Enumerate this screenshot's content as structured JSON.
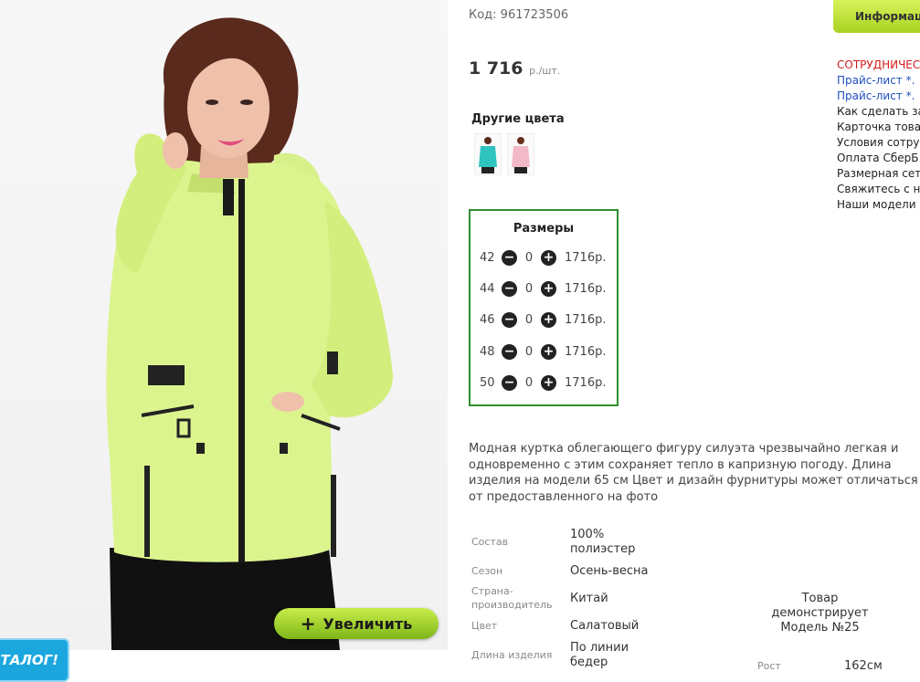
{
  "product": {
    "code": "Код: 961723506",
    "price": "1 716",
    "price_unit": "р./шт."
  },
  "colors": {
    "title": "Другие цвета",
    "thumbs": [
      {
        "name": "turquoise-jacket",
        "color": "#2fc4c0"
      },
      {
        "name": "pink-jacket",
        "color": "#f2b9c8"
      }
    ]
  },
  "sizes": {
    "title": "Размеры",
    "rows": [
      {
        "size": "42",
        "qty": "0",
        "price": "1716р."
      },
      {
        "size": "44",
        "qty": "0",
        "price": "1716р."
      },
      {
        "size": "46",
        "qty": "0",
        "price": "1716р."
      },
      {
        "size": "48",
        "qty": "0",
        "price": "1716р."
      },
      {
        "size": "50",
        "qty": "0",
        "price": "1716р."
      }
    ]
  },
  "description": "Модная куртка облегающего фигуру силуэта чрезвычайно легкая и одновременно с этим сохраняет тепло в капризную погоду. Длина изделия на модели 65 см Цвет и дизайн фурнитуры может отличаться от предоставленного на фото",
  "specs": [
    {
      "label": "Состав",
      "value": "100% полиэстер"
    },
    {
      "label": "Сезон",
      "value": "Осень-весна"
    },
    {
      "label": "Страна-производитель",
      "value": "Китай"
    },
    {
      "label": "Цвет",
      "value": "Салатовый"
    },
    {
      "label": "Длина изделия",
      "value": "По линии бедер"
    }
  ],
  "model": {
    "note": "Товар демонстрирует Модель №25",
    "height_label": "Рост",
    "height_value": "162см"
  },
  "gallery": {
    "zoom_label": "Увеличить",
    "zoom_icon": "plus-icon",
    "catalog_badge": "ТАЛОГ!"
  },
  "sidebar": {
    "info_tab": "Информац",
    "links": [
      {
        "text": "СОТРУДНИЧЕС",
        "style": "red"
      },
      {
        "text": "Прайс-лист *.",
        "style": "blue"
      },
      {
        "text": "Прайс-лист *.",
        "style": "blue"
      },
      {
        "text": "Как сделать за",
        "style": "dark"
      },
      {
        "text": "Карточка това",
        "style": "dark"
      },
      {
        "text": "Условия сотру",
        "style": "dark"
      },
      {
        "text": "Оплата СберБ",
        "style": "dark"
      },
      {
        "text": "Размерная сет",
        "style": "dark"
      },
      {
        "text": "Свяжитесь с н",
        "style": "dark"
      },
      {
        "text": "Наши модели",
        "style": "dark"
      }
    ]
  },
  "colors_palette": {
    "accent_green": "#2f8f2f",
    "button_green": "#a8d222",
    "link_blue": "#1f4fbf",
    "link_red": "#d21b1b"
  }
}
